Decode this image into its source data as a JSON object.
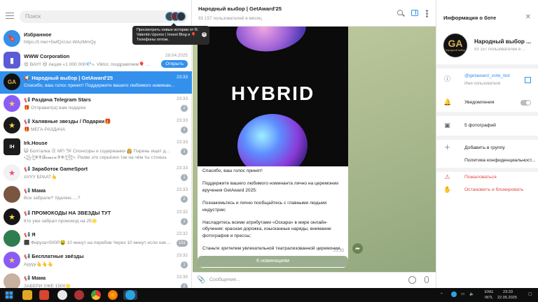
{
  "search": {
    "placeholder": "Поиск"
  },
  "tooltip": {
    "text": "Просмотреть новые истории от R. Valentin Uporov | Invest Blog и 🎈 Телефоны оптом."
  },
  "chats": [
    {
      "name": "Избранное",
      "msg": "https://t.me/+5wfQcUur-WAzMmQy",
      "time": "",
      "badge": "",
      "avatar_color": "#3390ec",
      "avatar_icon": "bookmark-icon"
    },
    {
      "name": "WWW Corporation",
      "msg": "😄 ВАУ!! 😄 Акция «1 000 000💎». Viktor, поздравляем🎈 с п...",
      "time": "28.04.2025",
      "badge": "",
      "button": "Открыть",
      "avatar_color": "#5b5bd6",
      "avatar_icon": "bar-chart-icon"
    },
    {
      "name": "📢 Народный выбор | GetAward'25",
      "msg": "Спасибо, ваш голос принят!  Поддержите вашего любимого номинан...",
      "time": "23:33",
      "badge": "",
      "avatar_color": "#121212",
      "avatar_icon": "ga-logo-icon"
    },
    {
      "name": "📢 Раздача Telegram Stars",
      "msg": "🎁 Отправил(а) вам подарок",
      "time": "23:33",
      "badge": "2",
      "avatar_color": "#8a5cf6",
      "avatar_icon": "star-icon"
    },
    {
      "name": "📢 Халявные звезды / Подарки🎁",
      "msg": "🎁 МЕГА-РАЗДАЧА",
      "time": "23:33",
      "badge": "1",
      "avatar_color": "#1a1a1a",
      "avatar_icon": "star-icon"
    },
    {
      "name": "Irk.House",
      "msg": "😺 Болталка  ⓪ МП  🛩 Спонсоры и содержанки  👸 Парень ищет д...  ꧁ঔৣ☬✞𝓓𝓮𝓶𝓸𝓷✞☬ঔৣ꧂: Разве это серьёзно так на чём ты стоишь😄 ...",
      "time": "23:33",
      "badge": "1",
      "avatar_color": "#1c1c1c",
      "avatar_icon": "irk-house-icon"
    },
    {
      "name": "📢 Заработок GameSport",
      "msg": "АУУУ БРААТ👆",
      "time": "23:33",
      "badge": "1",
      "avatar_color": "#f2f2f2",
      "avatar_icon": "star-icon"
    },
    {
      "name": "📢 Мама",
      "msg": "Все забрали? Удалею.....?",
      "time": "23:33",
      "badge": "2",
      "avatar_color": "#7a5540",
      "avatar_icon": "photo-icon"
    },
    {
      "name": "📢 ПРОМОКОДЫ НА ЗВЕЗДЫ ТУТ",
      "msg": "Кто уже забрал промокод на 25🌟",
      "time": "23:32",
      "badge": "1",
      "avatar_color": "#161616",
      "avatar_icon": "star-icon"
    },
    {
      "name": "📢 Я",
      "msg": "⬛ Фируза+500Р🤑 10 минут на перебив  Через 10 минут если никт...",
      "time": "23:32",
      "badge": "151",
      "avatar_color": "#2e7d4f",
      "avatar_icon": "photo-icon"
    },
    {
      "name": "📢 Бесплатные звёзды",
      "msg": "Ауууу👆👆👆",
      "time": "23:32",
      "badge": "1",
      "avatar_color": "#8a5cf6",
      "avatar_icon": "star-icon"
    },
    {
      "name": "📢 Мама",
      "msg": "ЗАБЕРИ УЖЕ 1500🌟",
      "time": "23:30",
      "badge": "2",
      "avatar_color": "#c7b1a0",
      "avatar_icon": "photo-icon"
    }
  ],
  "header": {
    "title": "Народный выбор | GetAward'25",
    "subtitle": "93 157 пользователей в месяц"
  },
  "message": {
    "hero_text": "HYBRID",
    "paragraphs": [
      "Спасибо, ваш голос принят!",
      "Поддержите вашего любимого номинанта лично на церемонии вручения GetAward 2025:",
      "Познакомьтесь и лично пообщайтесь с главными людьми индустрии;",
      "Насладитесь всеми атрибутами «Оскара» в мире онлайн-обучения: красная дорожка, изысканные наряды, внимание фотографов и прессы;",
      "Станьте зрителем увлекательной театрализованной церемонии."
    ],
    "time": "23:33",
    "inline_button": "К номинациям"
  },
  "compose": {
    "placeholder": "Сообщение..."
  },
  "info": {
    "title": "Информация о боте",
    "name": "Народный выбор ...",
    "subtitle": "93 157 пользователей в ...",
    "avatar_text": "GA",
    "avatar_sub": "Народный выбор",
    "username": "@getaward_vote_bot",
    "username_label": "Имя пользователя",
    "notifications": "Уведомления",
    "photos": "5 фотографий",
    "add_group": "Добавить в группу",
    "privacy": "Политика конфиденциальност...",
    "report": "Пожаловаться",
    "block": "Остановить и блокировать"
  },
  "tray": {
    "lang1": "ENG",
    "lang2": "INTL",
    "time": "23:33",
    "date": "22.05.2025"
  },
  "colors": {
    "accent": "#3390ec",
    "danger": "#e0463f"
  }
}
